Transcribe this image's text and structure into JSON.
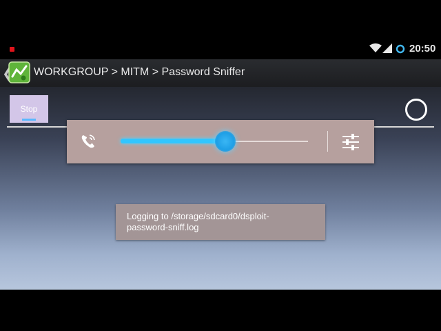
{
  "status_bar": {
    "time": "20:50",
    "icons": [
      "recording-dot-icon",
      "wifi-icon",
      "signal-icon",
      "sync-icon"
    ]
  },
  "action_bar": {
    "title": "WORKGROUP > MITM > Password Sniffer",
    "app_icon": "dsploit-app-icon",
    "back_icon": "back-chevron-icon"
  },
  "content": {
    "stop_button_label": "Stop",
    "activity_indicator": "progress-ring-icon"
  },
  "volume_panel": {
    "stream_icon": "phone-ring-icon",
    "level_fraction": 0.56,
    "settings_icon": "sliders-settings-icon"
  },
  "toast": {
    "line1": "Logging to /storage/sdcard0/dsploit-",
    "line2": "password-sniff.log"
  },
  "colors": {
    "accent": "#32c6ff",
    "recording": "#e0141b",
    "stop_button_bg": "#d3c6e8",
    "panel_bg": "#b6a09e",
    "toast_bg": "#a39596"
  }
}
